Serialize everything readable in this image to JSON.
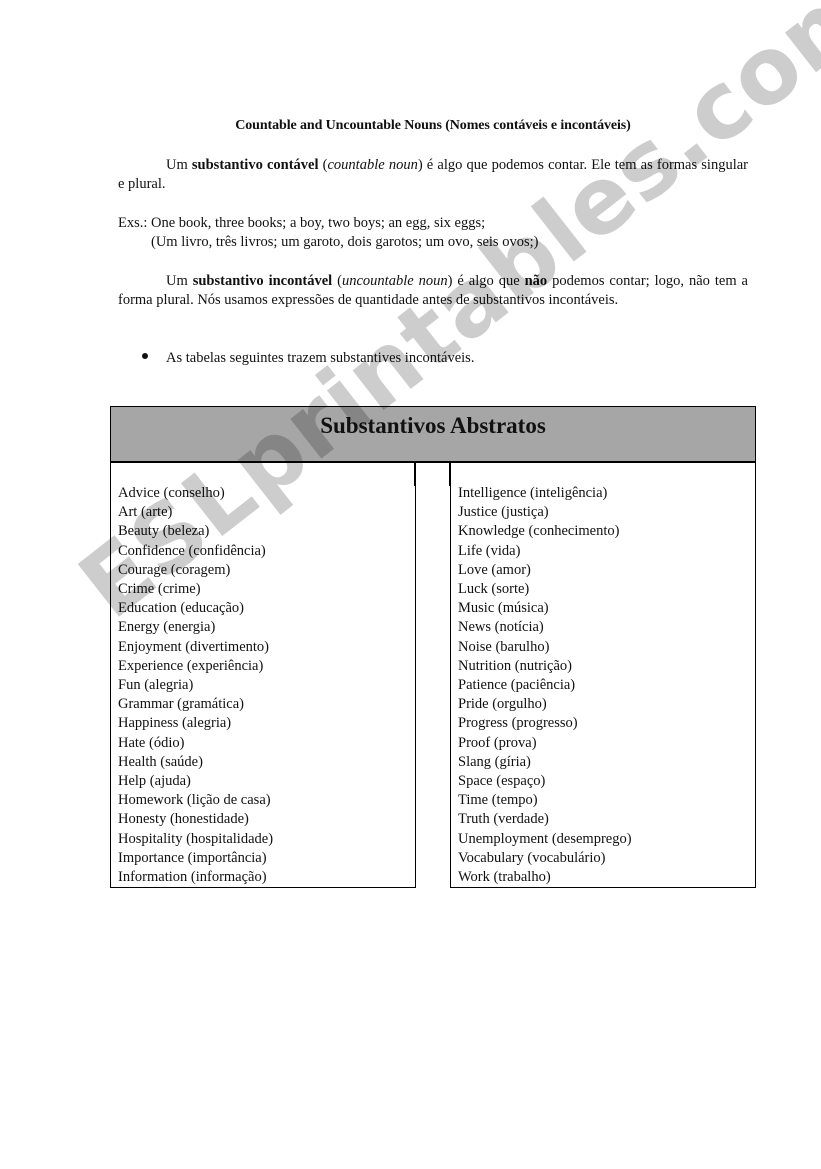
{
  "document": {
    "title": "Countable and Uncountable Nouns (Nomes contáveis e incontáveis)",
    "paragraph1": {
      "prefix": "Um ",
      "bold": "substantivo contável",
      "middle1": " (",
      "italic": "countable noun",
      "suffix": ") é algo que podemos contar. Ele tem as formas singular e plural."
    },
    "examples": {
      "line1": "Exs.: One book, three books; a boy, two boys; an egg, six eggs;",
      "line2": "(Um livro, três livros; um garoto, dois garotos; um ovo, seis ovos;)"
    },
    "paragraph2": {
      "prefix": "Um ",
      "bold": "substantivo incontável",
      "middle1": " (",
      "italic": "uncountable noun",
      "middle2": ") é algo que ",
      "bold2": "não",
      "suffix": " podemos contar; logo, não tem a forma plural. Nós usamos expressões de quantidade antes de substantivos incontáveis."
    },
    "bullet": "As tabelas seguintes trazem substantives incontáveis."
  },
  "table": {
    "header": "Substantivos Abstratos",
    "left_items": [
      "Advice (conselho)",
      "Art (arte)",
      "Beauty (beleza)",
      "Confidence (confidência)",
      "Courage (coragem)",
      "Crime (crime)",
      "Education (educação)",
      "Energy (energia)",
      "Enjoyment (divertimento)",
      "Experience (experiência)",
      "Fun (alegria)",
      "Grammar (gramática)",
      "Happiness (alegria)",
      "Hate (ódio)",
      "Health (saúde)",
      "Help (ajuda)",
      "Homework (lição de casa)",
      "Honesty (honestidade)",
      "Hospitality (hospitalidade)",
      "Importance (importância)",
      "Information (informação)"
    ],
    "right_items": [
      "Intelligence (inteligência)",
      "Justice (justiça)",
      "Knowledge (conhecimento)",
      "Life (vida)",
      "Love (amor)",
      "Luck (sorte)",
      "Music (música)",
      "News (notícia)",
      "Noise (barulho)",
      "Nutrition (nutrição)",
      "Patience (paciência)",
      "Pride (orgulho)",
      "Progress (progresso)",
      "Proof (prova)",
      "Slang (gíria)",
      "Space (espaço)",
      "Time (tempo)",
      "Truth (verdade)",
      "Unemployment (desemprego)",
      "Vocabulary (vocabulário)",
      "Work (trabalho)"
    ]
  },
  "watermark": "ESLprintables.com",
  "colors": {
    "header_bg": "#a6a6a6",
    "watermark": "#c4c4c4"
  }
}
